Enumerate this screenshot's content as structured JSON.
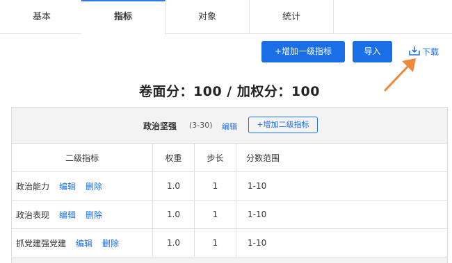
{
  "tabs": [
    {
      "label": "基本"
    },
    {
      "label": "指标",
      "active": true
    },
    {
      "label": "对象"
    },
    {
      "label": "统计"
    }
  ],
  "toolbar": {
    "add_level1": "+增加一级指标",
    "import": "导入",
    "download": "下载"
  },
  "summary": "卷面分：100 / 加权分：100",
  "group": {
    "title": "政治坚强",
    "range": "(3-30)",
    "edit": "编辑",
    "add_level2": "+增加二级指标"
  },
  "table": {
    "headers": [
      "二级指标",
      "权重",
      "步长",
      "分数范围"
    ],
    "rows": [
      {
        "name": "政治能力",
        "edit": "编辑",
        "delete": "删除",
        "weight": "1.0",
        "step": "1",
        "range": "1-10"
      },
      {
        "name": "政治表现",
        "edit": "编辑",
        "delete": "删除",
        "weight": "1.0",
        "step": "1",
        "range": "1-10"
      },
      {
        "name": "抓党建强党建",
        "edit": "编辑",
        "delete": "删除",
        "weight": "1.0",
        "step": "1",
        "range": "1-10"
      }
    ]
  },
  "colors": {
    "accent": "#1b6fe6",
    "annotation_arrow": "#f0883a"
  }
}
